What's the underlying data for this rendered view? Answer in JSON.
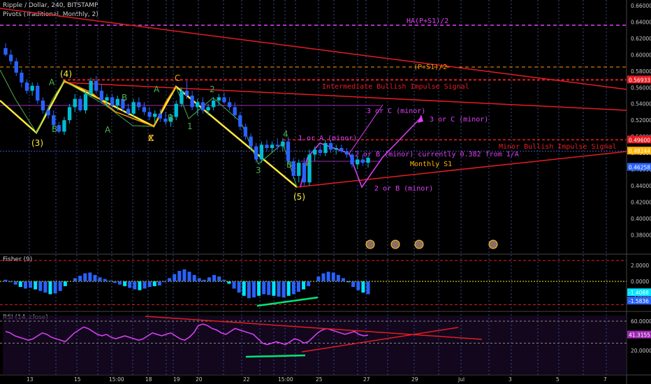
{
  "header": {
    "symbol_line": "Ripple / Dollar, 240, BITSTAMP",
    "pivots_line": "Pivots (Traditional, Monthly, 2)"
  },
  "chart_data": {
    "type": "candlestick",
    "main_panel": {
      "price_axis_ticks": [
        "0.66000",
        "0.64000",
        "0.62000",
        "0.60000",
        "0.58000",
        "0.56000",
        "0.54000",
        "0.52000",
        "0.50000",
        "0.48000",
        "0.46000",
        "0.44000",
        "0.42000",
        "0.40000",
        "0.38000"
      ],
      "price_tags": [
        {
          "label": "0.56933",
          "color": "#e51c23",
          "price": 0.56933
        },
        {
          "label": "0.49600",
          "color": "#e51c23",
          "price": 0.496
        },
        {
          "label": "0.48244",
          "color": "#ffb300",
          "price": 0.48244
        },
        {
          "label": "0.46258",
          "color": "#2962ff",
          "price": 0.46258
        }
      ],
      "levels": [
        {
          "label": "HA(P+S1)/2",
          "price": 0.636,
          "color": "#e040fb",
          "style": "dashed"
        },
        {
          "label": "(P+S1)/2",
          "price": 0.585,
          "color": "#ff9800",
          "style": "dashed"
        },
        {
          "label": "Intermediate Bullish Impulse Signal",
          "price": 0.5693,
          "color": "#e51c23",
          "style": "dashed"
        },
        {
          "label": "Minor Bullish Impulse Signal",
          "price": 0.496,
          "color": "#e51c23",
          "style": "dashed"
        },
        {
          "label": "Monthly S1",
          "price": 0.4822,
          "color": "#3f51b5",
          "style": "dotted"
        }
      ],
      "wave_labels": [
        "(3)",
        "(4)",
        "(5)",
        "A",
        "B",
        "A",
        "B",
        "C",
        "X",
        "A",
        "B",
        "C",
        "1",
        "2",
        "3",
        "4",
        "A",
        "B"
      ],
      "annotations": [
        "3 or C (minor)",
        "3 or C (minor)",
        "1 or A (minor)",
        "2 or B (minor) currently 0.382 from 1/A",
        "2 or B (minor)"
      ],
      "candles": [
        {
          "o": 0.608,
          "h": 0.614,
          "l": 0.598,
          "c": 0.6
        },
        {
          "o": 0.6,
          "h": 0.606,
          "l": 0.588,
          "c": 0.592
        },
        {
          "o": 0.592,
          "h": 0.596,
          "l": 0.574,
          "c": 0.578
        },
        {
          "o": 0.578,
          "h": 0.582,
          "l": 0.56,
          "c": 0.566
        },
        {
          "o": 0.566,
          "h": 0.57,
          "l": 0.552,
          "c": 0.556
        },
        {
          "o": 0.556,
          "h": 0.566,
          "l": 0.55,
          "c": 0.562
        },
        {
          "o": 0.562,
          "h": 0.566,
          "l": 0.54,
          "c": 0.544
        },
        {
          "o": 0.544,
          "h": 0.548,
          "l": 0.528,
          "c": 0.532
        },
        {
          "o": 0.532,
          "h": 0.538,
          "l": 0.522,
          "c": 0.526
        },
        {
          "o": 0.526,
          "h": 0.532,
          "l": 0.51,
          "c": 0.514
        },
        {
          "o": 0.514,
          "h": 0.518,
          "l": 0.504,
          "c": 0.506
        },
        {
          "o": 0.506,
          "h": 0.524,
          "l": 0.502,
          "c": 0.52
        },
        {
          "o": 0.52,
          "h": 0.54,
          "l": 0.516,
          "c": 0.536
        },
        {
          "o": 0.536,
          "h": 0.552,
          "l": 0.53,
          "c": 0.546
        },
        {
          "o": 0.546,
          "h": 0.55,
          "l": 0.53,
          "c": 0.532
        },
        {
          "o": 0.532,
          "h": 0.556,
          "l": 0.528,
          "c": 0.552
        },
        {
          "o": 0.552,
          "h": 0.572,
          "l": 0.548,
          "c": 0.568
        },
        {
          "o": 0.568,
          "h": 0.574,
          "l": 0.552,
          "c": 0.556
        },
        {
          "o": 0.556,
          "h": 0.564,
          "l": 0.54,
          "c": 0.544
        },
        {
          "o": 0.544,
          "h": 0.552,
          "l": 0.536,
          "c": 0.548
        },
        {
          "o": 0.548,
          "h": 0.552,
          "l": 0.534,
          "c": 0.538
        },
        {
          "o": 0.538,
          "h": 0.55,
          "l": 0.532,
          "c": 0.546
        },
        {
          "o": 0.546,
          "h": 0.55,
          "l": 0.53,
          "c": 0.534
        },
        {
          "o": 0.534,
          "h": 0.54,
          "l": 0.524,
          "c": 0.528
        },
        {
          "o": 0.528,
          "h": 0.546,
          "l": 0.524,
          "c": 0.542
        },
        {
          "o": 0.542,
          "h": 0.548,
          "l": 0.532,
          "c": 0.536
        },
        {
          "o": 0.536,
          "h": 0.542,
          "l": 0.526,
          "c": 0.53
        },
        {
          "o": 0.53,
          "h": 0.536,
          "l": 0.52,
          "c": 0.524
        },
        {
          "o": 0.524,
          "h": 0.532,
          "l": 0.516,
          "c": 0.528
        },
        {
          "o": 0.528,
          "h": 0.534,
          "l": 0.518,
          "c": 0.522
        },
        {
          "o": 0.522,
          "h": 0.53,
          "l": 0.514,
          "c": 0.518
        },
        {
          "o": 0.518,
          "h": 0.528,
          "l": 0.512,
          "c": 0.524
        },
        {
          "o": 0.524,
          "h": 0.544,
          "l": 0.52,
          "c": 0.54
        },
        {
          "o": 0.54,
          "h": 0.56,
          "l": 0.536,
          "c": 0.556
        },
        {
          "o": 0.556,
          "h": 0.568,
          "l": 0.546,
          "c": 0.55
        },
        {
          "o": 0.55,
          "h": 0.556,
          "l": 0.532,
          "c": 0.536
        },
        {
          "o": 0.536,
          "h": 0.546,
          "l": 0.526,
          "c": 0.542
        },
        {
          "o": 0.542,
          "h": 0.548,
          "l": 0.528,
          "c": 0.532
        },
        {
          "o": 0.532,
          "h": 0.54,
          "l": 0.526,
          "c": 0.536
        },
        {
          "o": 0.536,
          "h": 0.548,
          "l": 0.532,
          "c": 0.544
        },
        {
          "o": 0.544,
          "h": 0.552,
          "l": 0.538,
          "c": 0.548
        },
        {
          "o": 0.548,
          "h": 0.554,
          "l": 0.54,
          "c": 0.542
        },
        {
          "o": 0.542,
          "h": 0.548,
          "l": 0.532,
          "c": 0.536
        },
        {
          "o": 0.536,
          "h": 0.542,
          "l": 0.522,
          "c": 0.526
        },
        {
          "o": 0.526,
          "h": 0.53,
          "l": 0.508,
          "c": 0.512
        },
        {
          "o": 0.512,
          "h": 0.516,
          "l": 0.496,
          "c": 0.5
        },
        {
          "o": 0.5,
          "h": 0.504,
          "l": 0.484,
          "c": 0.488
        },
        {
          "o": 0.488,
          "h": 0.492,
          "l": 0.468,
          "c": 0.472
        },
        {
          "o": 0.472,
          "h": 0.494,
          "l": 0.468,
          "c": 0.49
        },
        {
          "o": 0.49,
          "h": 0.496,
          "l": 0.482,
          "c": 0.486
        },
        {
          "o": 0.486,
          "h": 0.494,
          "l": 0.48,
          "c": 0.49
        },
        {
          "o": 0.49,
          "h": 0.498,
          "l": 0.484,
          "c": 0.488
        },
        {
          "o": 0.488,
          "h": 0.498,
          "l": 0.482,
          "c": 0.494
        },
        {
          "o": 0.494,
          "h": 0.5,
          "l": 0.466,
          "c": 0.47
        },
        {
          "o": 0.47,
          "h": 0.474,
          "l": 0.448,
          "c": 0.452
        },
        {
          "o": 0.452,
          "h": 0.472,
          "l": 0.444,
          "c": 0.468
        },
        {
          "o": 0.468,
          "h": 0.474,
          "l": 0.44,
          "c": 0.444
        },
        {
          "o": 0.444,
          "h": 0.484,
          "l": 0.44,
          "c": 0.478
        },
        {
          "o": 0.478,
          "h": 0.488,
          "l": 0.47,
          "c": 0.484
        },
        {
          "o": 0.484,
          "h": 0.49,
          "l": 0.476,
          "c": 0.48
        },
        {
          "o": 0.48,
          "h": 0.496,
          "l": 0.476,
          "c": 0.492
        },
        {
          "o": 0.492,
          "h": 0.496,
          "l": 0.48,
          "c": 0.484
        },
        {
          "o": 0.484,
          "h": 0.49,
          "l": 0.478,
          "c": 0.486
        },
        {
          "o": 0.486,
          "h": 0.49,
          "l": 0.48,
          "c": 0.482
        },
        {
          "o": 0.482,
          "h": 0.486,
          "l": 0.474,
          "c": 0.478
        },
        {
          "o": 0.478,
          "h": 0.48,
          "l": 0.462,
          "c": 0.466
        },
        {
          "o": 0.466,
          "h": 0.476,
          "l": 0.46,
          "c": 0.472
        },
        {
          "o": 0.472,
          "h": 0.478,
          "l": 0.464,
          "c": 0.468
        },
        {
          "o": 0.468,
          "h": 0.476,
          "l": 0.462,
          "c": 0.474
        }
      ]
    },
    "fisher_panel": {
      "title": "Fisher (9)",
      "axis_ticks": [
        "2.0000",
        "0.0000",
        "-2.0000"
      ],
      "tags": [
        {
          "label": "-1.4088",
          "color": "#00e5ff"
        },
        {
          "label": "-1.5836",
          "color": "#2962ff"
        }
      ],
      "values": [
        0.2,
        -0.1,
        -0.4,
        -0.7,
        -0.9,
        -0.8,
        -1.0,
        -1.2,
        -1.4,
        -1.6,
        -1.5,
        -1.2,
        -0.6,
        0.0,
        0.4,
        0.7,
        1.0,
        1.1,
        0.8,
        0.5,
        0.3,
        0.1,
        -0.2,
        -0.4,
        -0.6,
        -0.8,
        -1.0,
        -1.1,
        -0.9,
        -0.7,
        -0.6,
        -0.5,
        -0.1,
        0.4,
        0.9,
        1.3,
        1.5,
        1.2,
        0.8,
        0.4,
        0.2,
        0.5,
        0.8,
        0.6,
        0.2,
        -0.3,
        -0.9,
        -1.4,
        -1.8,
        -2.1,
        -2.0,
        -1.8,
        -1.6,
        -1.7,
        -1.8,
        -1.9,
        -2.0,
        -1.8,
        -1.6,
        -1.3,
        -1.0,
        -0.6,
        0.0,
        0.6,
        1.0,
        1.2,
        1.1,
        0.8,
        0.4,
        -0.1,
        -0.7,
        -1.1,
        -1.4,
        -1.6
      ]
    },
    "rsi_panel": {
      "title": "RSI (14, close)",
      "axis_ticks": [
        "60.0000",
        "20.0000"
      ],
      "tag": "41.3155",
      "values": [
        46,
        44,
        40,
        38,
        36,
        34,
        36,
        40,
        44,
        42,
        38,
        36,
        34,
        32,
        38,
        44,
        48,
        52,
        50,
        46,
        42,
        40,
        42,
        38,
        36,
        38,
        40,
        38,
        36,
        34,
        36,
        40,
        44,
        42,
        40,
        42,
        44,
        40,
        36,
        34,
        38,
        44,
        54,
        56,
        54,
        50,
        48,
        44,
        42,
        46,
        50,
        48,
        46,
        44,
        42,
        36,
        30,
        28,
        30,
        32,
        30,
        28,
        32,
        36,
        34,
        30,
        32,
        38,
        44,
        48,
        50,
        48,
        46,
        44,
        42,
        44,
        46,
        42,
        40,
        41
      ]
    },
    "time_axis": [
      "13",
      "15",
      "15:00",
      "18",
      "19",
      "20",
      "22",
      "15:00",
      "25",
      "27",
      "29",
      "Jul",
      "3",
      "5",
      "7"
    ]
  }
}
